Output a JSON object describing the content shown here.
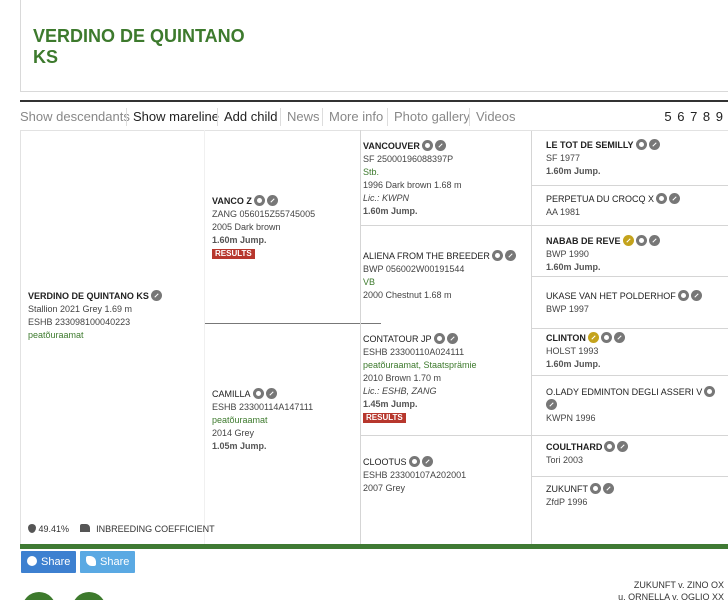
{
  "horse_title": "VERDINO DE QUINTANO\nKS",
  "tabs": [
    "Show descendants",
    "Show mareline",
    "Add child",
    "News",
    "More info",
    "Photo gallery",
    "Videos"
  ],
  "pages": "5 6 7 8 9",
  "subject": {
    "name": "VERDINO DE QUINTANO KS",
    "line1": "Stallion 2021 Grey 1.69 m",
    "line2": "ESHB 233098100040223",
    "line3": "peatõuraamat"
  },
  "sire": {
    "name": "VANCO Z",
    "line1": "ZANG 056015Z55745005",
    "line2": "2005 Dark brown",
    "line3": "1.60m Jump.",
    "badge": "RESULTS"
  },
  "dam": {
    "name": "CAMILLA",
    "line1": "ESHB 23300114A147111",
    "line2": "peatõuraamat",
    "line3": "2014 Grey",
    "line4": "1.05m Jump."
  },
  "ss": {
    "name": "VANCOUVER",
    "line1": "SF 25000196088397P",
    "line2": "Stb.",
    "line3": "1996 Dark brown 1.68 m",
    "line4": "Lic.: KWPN",
    "line5": "1.60m Jump."
  },
  "sd": {
    "name": "ALIENA FROM THE BREEDER",
    "line1": "BWP 056002W00191544",
    "line2": "VB",
    "line3": "2000 Chestnut 1.68 m"
  },
  "ds": {
    "name": "CONTATOUR JP",
    "line1": "ESHB 23300110A024111",
    "line2": "peatõuraamat, Staatsprämie",
    "line3": "2010 Brown 1.70 m",
    "line4": "Lic.: ESHB, ZANG",
    "line5": "1.45m Jump.",
    "badge": "RESULTS"
  },
  "dd": {
    "name": "CLOOTUS",
    "line1": "ESHB 23300107A202001",
    "line2": "2007 Grey"
  },
  "g": [
    {
      "name": "LE TOT DE SEMILLY",
      "line1": "SF 1977",
      "line2": "1.60m Jump."
    },
    {
      "name": "PERPETUA DU CROCQ X",
      "line1": "AA 1981"
    },
    {
      "name": "NABAB DE REVE",
      "line1": "BWP 1990",
      "line2": "1.60m Jump."
    },
    {
      "name": "UKASE VAN HET POLDERHOF",
      "line1": "BWP 1997"
    },
    {
      "name": "CLINTON",
      "line1": "HOLST 1993",
      "line2": "1.60m Jump."
    },
    {
      "name": "O.LADY EDMINTON DEGLI ASSERI V",
      "line1": "KWPN 1996"
    },
    {
      "name": "COULTHARD",
      "line1": "Tori 2003"
    },
    {
      "name": "ZUKUNFT",
      "line1": "ZfdP 1996"
    }
  ],
  "inbreeding": {
    "value": "49.41%",
    "label": "INBREEDING COEFFICIENT"
  },
  "share": {
    "facebook": "Share",
    "twitter": "Share"
  },
  "footer": {
    "line1": "ZUKUNFT v. ZINO OX",
    "line2": "u. ORNELLA v. OGLIO XX"
  },
  "colors": {
    "brand_green": "#3d7a2d",
    "results_red": "#b7372d",
    "facebook_blue": "#3d80d0",
    "twitter_blue": "#5aa9e3"
  }
}
